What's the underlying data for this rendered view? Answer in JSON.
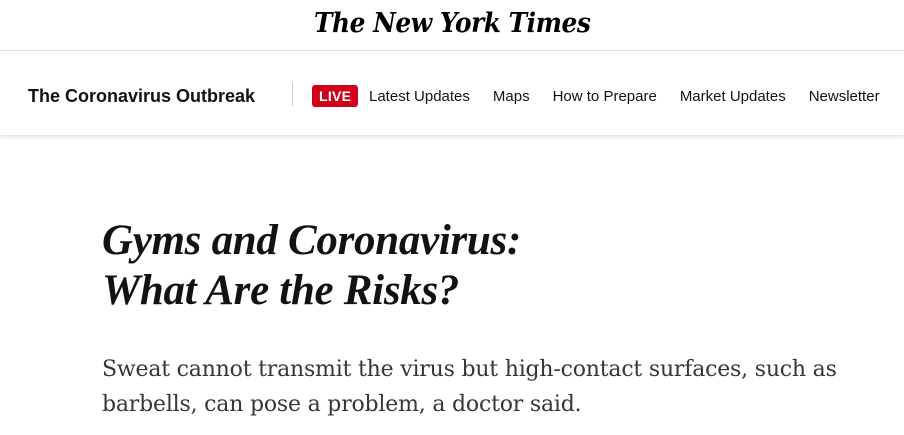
{
  "masthead": {
    "logo_text": "The New York Times"
  },
  "nav": {
    "section_title": "The Coronavirus Outbreak",
    "live_label": "LIVE",
    "links": [
      "Latest Updates",
      "Maps",
      "How to Prepare",
      "Market Updates",
      "Newsletter"
    ],
    "live_color": "#d0021b"
  },
  "article": {
    "headline_line1": "Gyms and Coronavirus:",
    "headline_line2": "What Are the Risks?",
    "summary": "Sweat cannot transmit the virus but high-contact surfaces, such as barbells, can pose a problem, a doctor said."
  }
}
